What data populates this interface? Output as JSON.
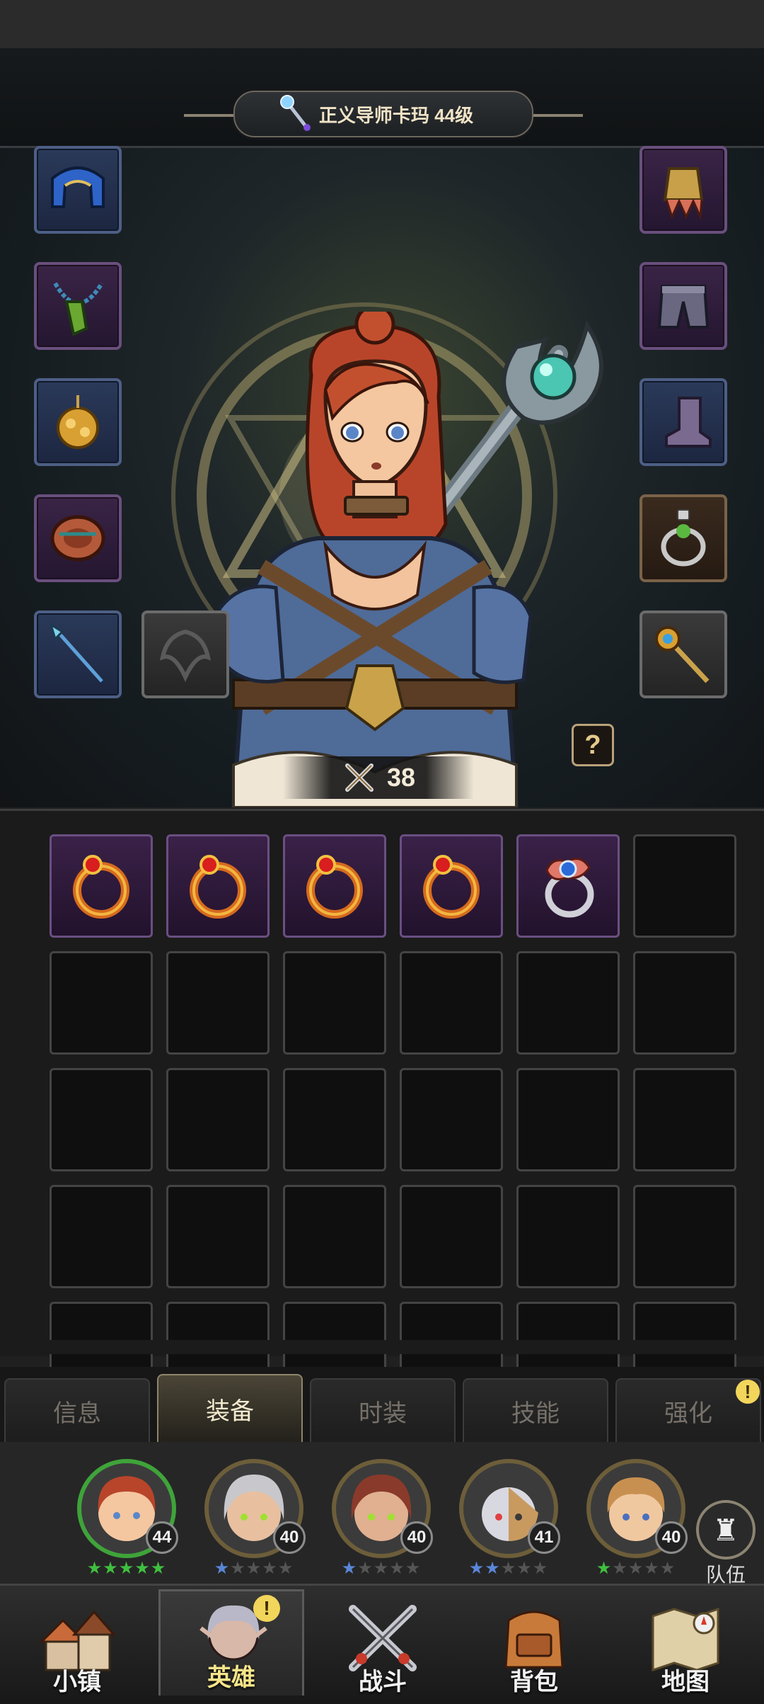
{
  "header": {
    "title": "正义导师卡玛 44级"
  },
  "equipment": {
    "left": [
      "hood-icon",
      "necklace-icon",
      "amulet-icon",
      "bracer-icon",
      "spear-icon",
      "offhand-empty-icon"
    ],
    "right": [
      "shoulder-icon",
      "pants-icon",
      "boots-icon",
      "ring-locked-icon",
      "staff-icon"
    ]
  },
  "power": {
    "value": "38"
  },
  "help": {
    "label": "?"
  },
  "inventory": {
    "items": [
      "ruby-ring-icon",
      "ruby-ring-icon",
      "ruby-ring-icon",
      "ruby-ring-icon",
      "sapphire-ring-icon"
    ]
  },
  "tabs": [
    {
      "label": "信息"
    },
    {
      "label": "装备"
    },
    {
      "label": "时装"
    },
    {
      "label": "技能"
    },
    {
      "label": "强化"
    }
  ],
  "tab_alert": "!",
  "heroes": [
    {
      "level": "40",
      "name": "hero-kama"
    },
    {
      "level": "40",
      "name": "hero-elf-silver"
    },
    {
      "level": "40",
      "name": "hero-elf-red"
    },
    {
      "level": "41",
      "name": "hero-masked"
    },
    {
      "level": "40",
      "name": "hero-blond"
    }
  ],
  "selected_hero_level": "44",
  "team": {
    "label": "队伍"
  },
  "nav": [
    {
      "label": "小镇"
    },
    {
      "label": "英雄"
    },
    {
      "label": "战斗"
    },
    {
      "label": "背包"
    },
    {
      "label": "地图"
    }
  ],
  "nav_alert": "!"
}
